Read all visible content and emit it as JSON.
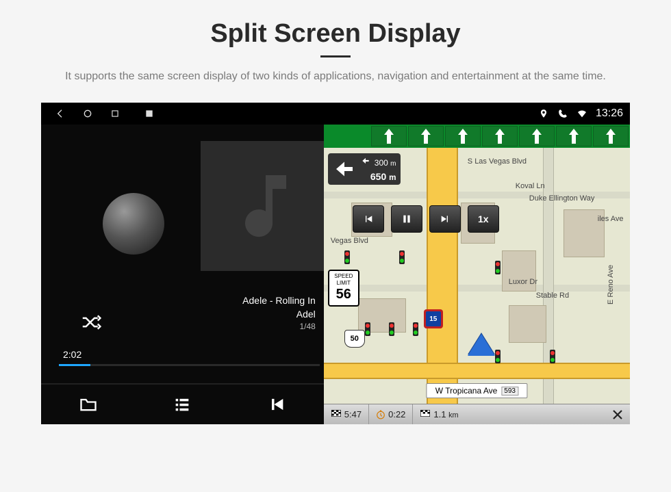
{
  "header": {
    "title": "Split Screen Display",
    "subtitle": "It supports the same screen display of two kinds of applications, navigation and entertainment at the same time."
  },
  "statusbar": {
    "time": "13:26"
  },
  "music": {
    "track_title": "Adele - Rolling In",
    "artist": "Adel",
    "track_index": "1/48",
    "elapsed": "2:02"
  },
  "nav": {
    "turn": {
      "sub_dist": "300",
      "sub_unit": "m",
      "main_dist": "650",
      "main_unit": "m"
    },
    "speed_limit_label": "SPEED LIMIT",
    "speed_limit_value": "56",
    "playback_speed": "1x",
    "streets": {
      "top": "S Las Vegas Blvd",
      "koval": "Koval Ln",
      "duke": "Duke Ellington Way",
      "luxor": "Luxor Dr",
      "stable": "Stable Rd",
      "reno": "E Reno Ave",
      "vegas": "Vegas Blvd",
      "iles": "iles Ave"
    },
    "road_name": "W Tropicana Ave",
    "road_num": "593",
    "route_us": "50",
    "route_i": "15",
    "eta": "5:47",
    "trip_time": "0:22",
    "trip_dist_value": "1.1",
    "trip_dist_unit": "km"
  }
}
